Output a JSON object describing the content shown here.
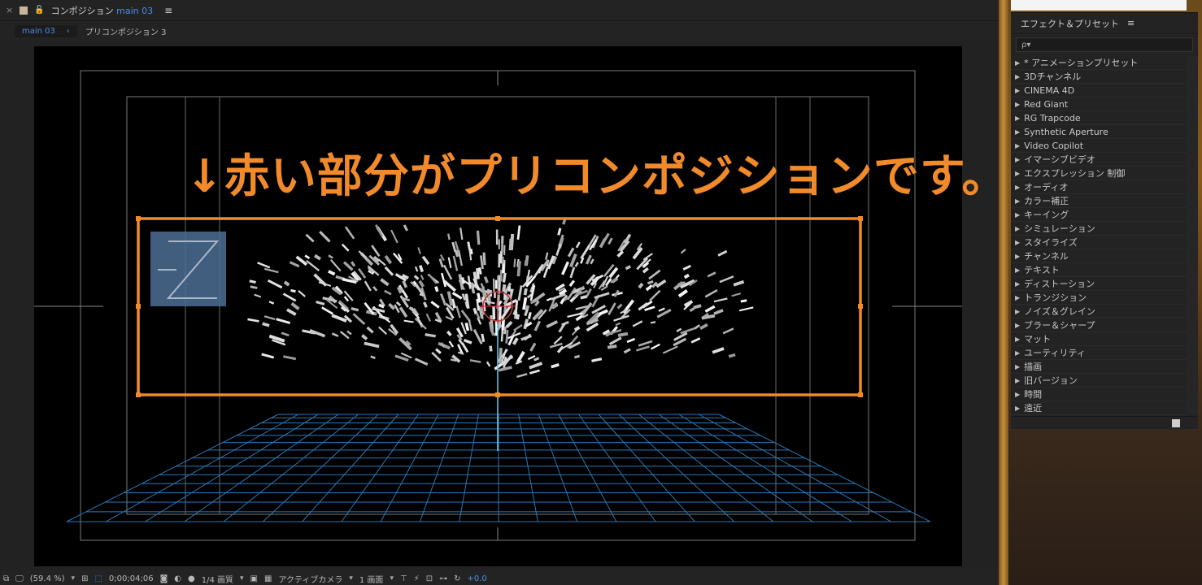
{
  "header": {
    "close": "×",
    "title_prefix": "コンポジション",
    "comp_name": "main 03",
    "menu": "≡"
  },
  "tabs": {
    "active": "main 03",
    "arrow": "‹",
    "other": "プリコンポジション 3"
  },
  "annotation": {
    "text": "↓赤い部分がプリコンポジションです。"
  },
  "toolbar": {
    "zoom": "(59.4 %)",
    "timecode": "0;00;04;06",
    "resolution": "1/4 画質",
    "camera": "アクティブカメラ",
    "views": "1 画面",
    "exposure": "+0.0"
  },
  "effects_panel": {
    "title": "エフェクト＆プリセット",
    "menu": "≡",
    "search_placeholder": "ρ▾",
    "items": [
      "* アニメーションプリセット",
      "3Dチャンネル",
      "CINEMA 4D",
      "Red Giant",
      "RG Trapcode",
      "Synthetic Aperture",
      "Video Copilot",
      "イマーシブビデオ",
      "エクスプレッション 制御",
      "オーディオ",
      "カラー補正",
      "キーイング",
      "シミュレーション",
      "スタイライズ",
      "チャンネル",
      "テキスト",
      "ディストーション",
      "トランジション",
      "ノイズ＆グレイン",
      "ブラー＆シャープ",
      "マット",
      "ユーティリティ",
      "描画",
      "旧バージョン",
      "時間",
      "遠近"
    ]
  },
  "colors": {
    "accent_blue": "#4c8ee6",
    "annotation_orange": "#f08a2a",
    "grid_blue": "#2a78b8"
  }
}
